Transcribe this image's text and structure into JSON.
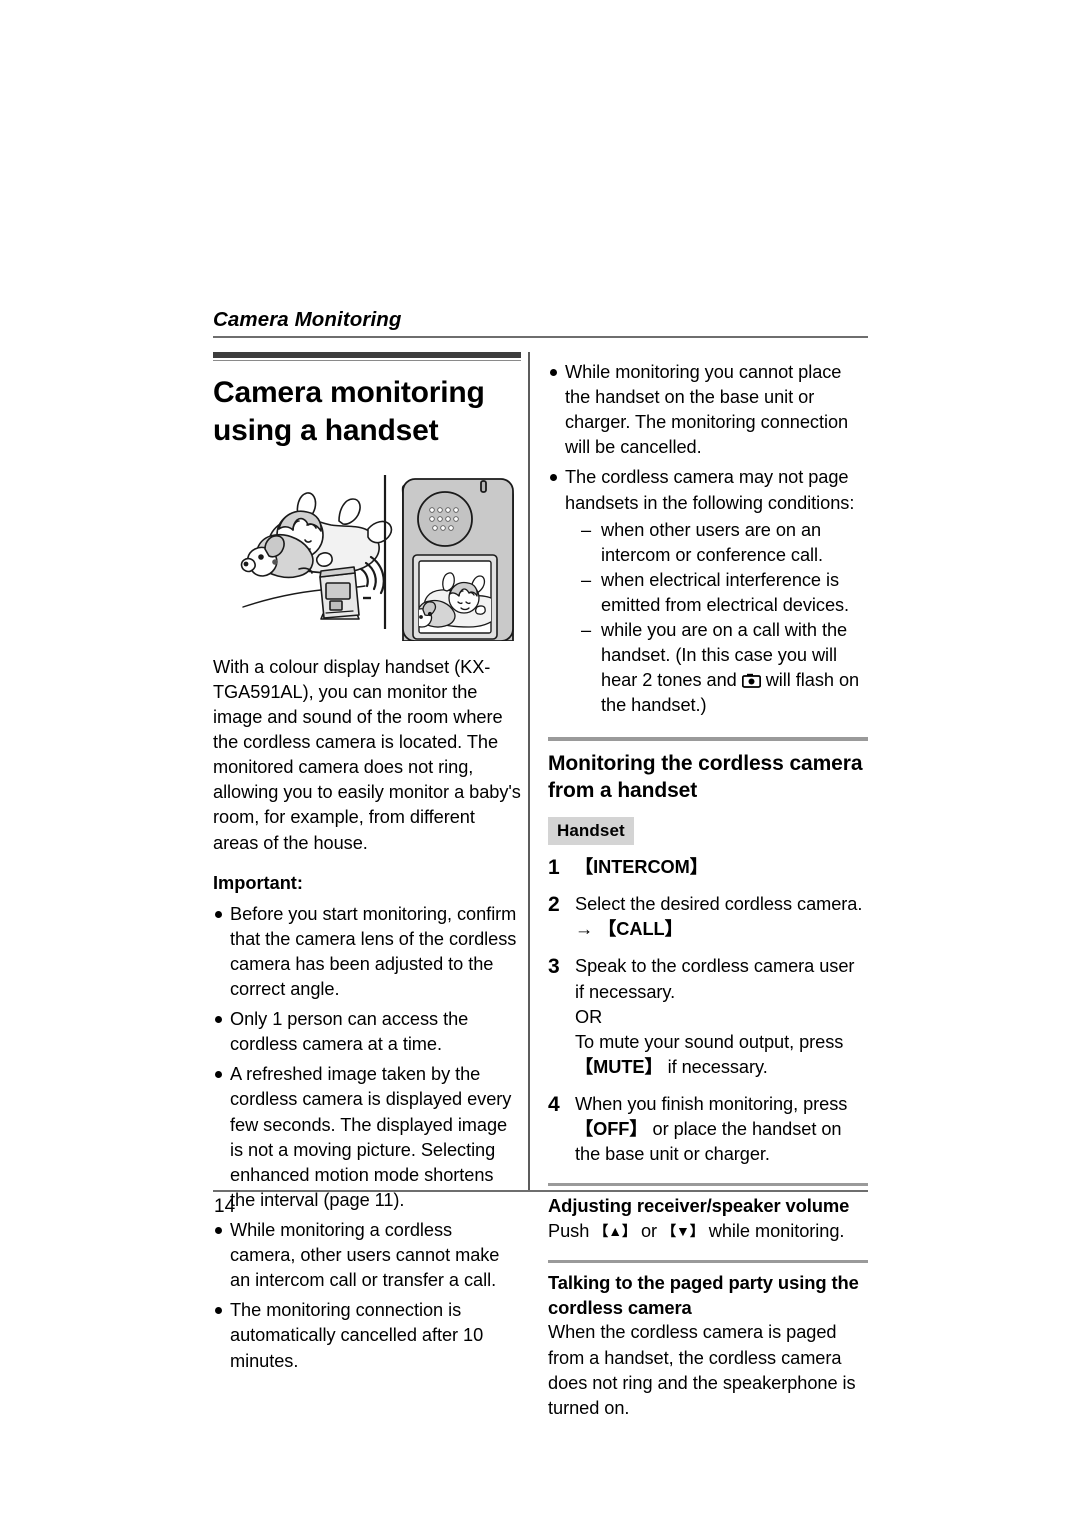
{
  "header": {
    "chapter": "Camera Monitoring"
  },
  "footer": {
    "page_number": "14"
  },
  "left_column": {
    "title": "Camera monitoring using a handset",
    "illustration": {
      "name": "baby-with-camera-and-handset-illustration",
      "alt": "A baby lying with a stuffed dog, a cordless camera transmitting, and a handset showing the image"
    },
    "intro": "With a colour display handset (KX-TGA591AL), you can monitor the image and sound of the room where the cordless camera is located. The monitored camera does not ring, allowing you to easily monitor a baby's room, for example, from different areas of the house.",
    "important_label": "Important:",
    "important_bullets": [
      "Before you start monitoring, confirm that the camera lens of the cordless camera has been adjusted to the correct angle.",
      "Only 1 person can access the cordless camera at a time.",
      "A refreshed image taken by the cordless camera is displayed every few seconds. The displayed image is not a moving picture. Selecting enhanced motion mode shortens the interval (page 11).",
      "While monitoring a cordless camera, other users cannot make an intercom call or transfer a call.",
      "The monitoring connection is automatically cancelled after 10 minutes."
    ]
  },
  "right_column": {
    "top_bullets": [
      {
        "text": "While monitoring you cannot place the handset on the base unit or charger. The monitoring connection will be cancelled.",
        "sub_items": []
      },
      {
        "text": "The cordless camera may not page handsets in the following conditions:",
        "sub_items": [
          "when other users are on an intercom or conference call.",
          "when electrical interference is emitted from electrical devices.",
          "while you are on a call with the handset. (In this case you will hear 2 tones and [camera-icon] will flash on the handset.)"
        ]
      }
    ],
    "sub_item_3_part1": "while you are on a call with the handset. (In this case you will hear 2 tones and ",
    "sub_item_3_part2": " will flash on the handset.)",
    "section_heading": "Monitoring the cordless camera from a handset",
    "device_badge": "Handset",
    "steps": [
      {
        "number": "1",
        "key": "【INTERCOM】",
        "text": ""
      },
      {
        "number": "2",
        "text": "Select the desired cordless camera.",
        "arrow_line_arrow": "→",
        "arrow_line_key": "【CALL】"
      },
      {
        "number": "3",
        "line1": "Speak to the cordless camera user if necessary.",
        "line2": "OR",
        "line3": "To mute your sound output, press ",
        "key": "【MUTE】",
        "line4": " if necessary."
      },
      {
        "number": "4",
        "line1": "When you finish monitoring, press ",
        "key": "【OFF】",
        "line2": " or place the handset on the base unit or charger."
      }
    ],
    "subsections": [
      {
        "heading": "Adjusting receiver/speaker volume",
        "body_prefix": "Push ",
        "key_up": "【▲】",
        "body_mid": " or ",
        "key_down": "【▼】",
        "body_suffix": " while monitoring."
      },
      {
        "heading": "Talking to the paged party using the cordless camera",
        "body": "When the cordless camera is paged from a handset, the cordless camera does not ring and the speakerphone is turned on."
      }
    ]
  },
  "colors": {
    "rule_gray": "#6e6e6e",
    "section_rule_gray": "#9a9a9a",
    "badge_bg": "#d4d4d4",
    "title_bar": "#3d3d3d"
  }
}
